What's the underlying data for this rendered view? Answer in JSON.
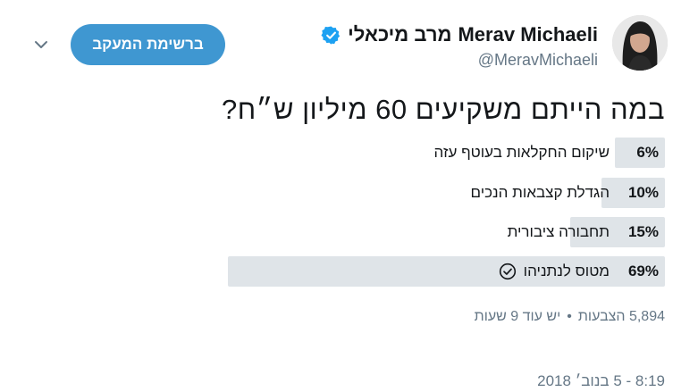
{
  "header": {
    "display_name_he": "מרב מיכאלי",
    "display_name_en": "Merav Michaeli",
    "handle": "@MeravMichaeli",
    "follow_button_label": "ברשימת המעקב"
  },
  "tweet": {
    "question": "במה הייתם משקיעים 60 מיליון ש״ח?",
    "poll": {
      "options": [
        {
          "percent_label": "6%",
          "percent": 6,
          "label": "שיקום החקלאות בעוטף עזה",
          "selected": false
        },
        {
          "percent_label": "10%",
          "percent": 10,
          "label": "הגדלת קצבאות הנכים",
          "selected": false
        },
        {
          "percent_label": "15%",
          "percent": 15,
          "label": "תחבורה ציבורית",
          "selected": false
        },
        {
          "percent_label": "69%",
          "percent": 69,
          "label": "מטוס לנתניהו",
          "selected": true
        }
      ],
      "votes": "5,894 הצבעות",
      "separator": "•",
      "time_left": "יש עוד 9 שעות"
    },
    "timestamp": "8:19 - 5 בנוב׳ 2018"
  },
  "colors": {
    "accent": "#3f97d1",
    "verified": "#1da1f2",
    "poll_bar": "#dfe4e8",
    "muted_text": "#657786"
  },
  "icons": {
    "menu": "chevron-down-icon",
    "verified": "verified-badge-icon",
    "selected": "check-circle-icon"
  }
}
